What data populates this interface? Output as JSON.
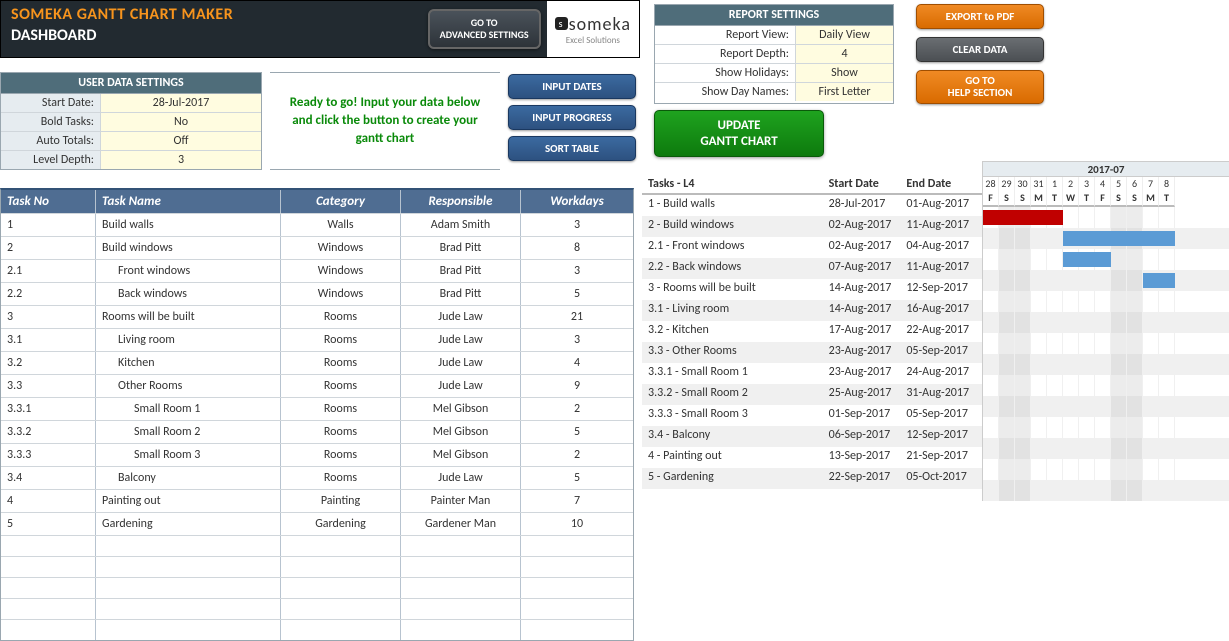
{
  "header": {
    "app_title": "SOMEKA GANTT CHART MAKER",
    "dash_title": "DASHBOARD",
    "adv_btn_l1": "GO TO",
    "adv_btn_l2": "ADVANCED SETTINGS",
    "logo_text": "someka",
    "logo_sub": "Excel Solutions"
  },
  "uds": {
    "title": "USER DATA SETTINGS",
    "rows": [
      {
        "label": "Start Date:",
        "value": "28-Jul-2017"
      },
      {
        "label": "Bold Tasks:",
        "value": "No"
      },
      {
        "label": "Auto Totals:",
        "value": "Off"
      },
      {
        "label": "Level Depth:",
        "value": "3"
      }
    ]
  },
  "ready_msg": "Ready to go! Input your data below and click the button to create your gantt chart",
  "act": {
    "input_dates": "INPUT DATES",
    "input_progress": "INPUT PROGRESS",
    "sort_table": "SORT TABLE"
  },
  "task_header": {
    "no": "Task No",
    "name": "Task Name",
    "cat": "Category",
    "resp": "Responsible",
    "wd": "Workdays"
  },
  "tasks": [
    {
      "no": "1",
      "name": "Build walls",
      "indent": 0,
      "cat": "Walls",
      "resp": "Adam Smith",
      "wd": "3"
    },
    {
      "no": "2",
      "name": "Build windows",
      "indent": 0,
      "cat": "Windows",
      "resp": "Brad Pitt",
      "wd": "8"
    },
    {
      "no": "2.1",
      "name": "Front windows",
      "indent": 1,
      "cat": "Windows",
      "resp": "Brad Pitt",
      "wd": "3"
    },
    {
      "no": "2.2",
      "name": "Back windows",
      "indent": 1,
      "cat": "Windows",
      "resp": "Brad Pitt",
      "wd": "5"
    },
    {
      "no": "3",
      "name": "Rooms will be built",
      "indent": 0,
      "cat": "Rooms",
      "resp": "Jude Law",
      "wd": "21"
    },
    {
      "no": "3.1",
      "name": "Living room",
      "indent": 1,
      "cat": "Rooms",
      "resp": "Jude Law",
      "wd": "3"
    },
    {
      "no": "3.2",
      "name": "Kitchen",
      "indent": 1,
      "cat": "Rooms",
      "resp": "Jude Law",
      "wd": "4"
    },
    {
      "no": "3.3",
      "name": "Other Rooms",
      "indent": 1,
      "cat": "Rooms",
      "resp": "Jude Law",
      "wd": "9"
    },
    {
      "no": "3.3.1",
      "name": "Small Room 1",
      "indent": 2,
      "cat": "Rooms",
      "resp": "Mel Gibson",
      "wd": "2"
    },
    {
      "no": "3.3.2",
      "name": "Small Room 2",
      "indent": 2,
      "cat": "Rooms",
      "resp": "Mel Gibson",
      "wd": "5"
    },
    {
      "no": "3.3.3",
      "name": "Small Room 3",
      "indent": 2,
      "cat": "Rooms",
      "resp": "Mel Gibson",
      "wd": "2"
    },
    {
      "no": "3.4",
      "name": "Balcony",
      "indent": 1,
      "cat": "Rooms",
      "resp": "Jude Law",
      "wd": "5"
    },
    {
      "no": "4",
      "name": "Painting out",
      "indent": 0,
      "cat": "Painting",
      "resp": "Painter Man",
      "wd": "7"
    },
    {
      "no": "5",
      "name": "Gardening",
      "indent": 0,
      "cat": "Gardening",
      "resp": "Gardener Man",
      "wd": "10"
    }
  ],
  "empty_rows": 5,
  "rs": {
    "title": "REPORT SETTINGS",
    "rows": [
      {
        "label": "Report View:",
        "value": "Daily View"
      },
      {
        "label": "Report Depth:",
        "value": "4"
      },
      {
        "label": "Show Holidays:",
        "value": "Show"
      },
      {
        "label": "Show Day Names:",
        "value": "First Letter"
      }
    ]
  },
  "rbtn": {
    "export": "EXPORT to PDF",
    "clear": "CLEAR DATA",
    "help_l1": "GO TO",
    "help_l2": "HELP SECTION",
    "update_l1": "UPDATE",
    "update_l2": "GANTT CHART"
  },
  "gantt_hdr": {
    "tasks": "Tasks - L4",
    "start": "Start Date",
    "end": "End Date",
    "month": "2017-07"
  },
  "gantt_rows": [
    {
      "task": "1 - Build walls",
      "start": "28-Jul-2017",
      "end": "01-Aug-2017"
    },
    {
      "task": "2 - Build windows",
      "start": "02-Aug-2017",
      "end": "11-Aug-2017"
    },
    {
      "task": "2.1 - Front windows",
      "start": "02-Aug-2017",
      "end": "04-Aug-2017"
    },
    {
      "task": "2.2 - Back windows",
      "start": "07-Aug-2017",
      "end": "11-Aug-2017"
    },
    {
      "task": "3 - Rooms will be built",
      "start": "14-Aug-2017",
      "end": "12-Sep-2017"
    },
    {
      "task": "3.1 - Living room",
      "start": "14-Aug-2017",
      "end": "16-Aug-2017"
    },
    {
      "task": "3.2 - Kitchen",
      "start": "17-Aug-2017",
      "end": "22-Aug-2017"
    },
    {
      "task": "3.3 - Other Rooms",
      "start": "23-Aug-2017",
      "end": "05-Sep-2017"
    },
    {
      "task": "3.3.1 - Small Room 1",
      "start": "23-Aug-2017",
      "end": "24-Aug-2017"
    },
    {
      "task": "3.3.2 - Small Room 2",
      "start": "25-Aug-2017",
      "end": "31-Aug-2017"
    },
    {
      "task": "3.3.3 - Small Room 3",
      "start": "01-Sep-2017",
      "end": "05-Sep-2017"
    },
    {
      "task": "3.4 - Balcony",
      "start": "06-Sep-2017",
      "end": "12-Sep-2017"
    },
    {
      "task": "4 - Painting out",
      "start": "13-Sep-2017",
      "end": "21-Sep-2017"
    },
    {
      "task": "5 - Gardening",
      "start": "22-Sep-2017",
      "end": "05-Oct-2017"
    }
  ],
  "chart_data": {
    "type": "gantt",
    "timeline_start": "2017-07-28",
    "visible_days": 12,
    "day_numbers": [
      "28",
      "29",
      "30",
      "31",
      "1",
      "2",
      "3",
      "4",
      "5",
      "6",
      "7",
      "8"
    ],
    "day_letters": [
      "F",
      "S",
      "S",
      "M",
      "T",
      "W",
      "T",
      "F",
      "S",
      "S",
      "M",
      "T"
    ],
    "weekend_idx": [
      1,
      2,
      8,
      9
    ],
    "bars": [
      {
        "row": 0,
        "start_idx": 0,
        "span": 5,
        "color": "red"
      },
      {
        "row": 1,
        "start_idx": 5,
        "span": 7,
        "color": "blue"
      },
      {
        "row": 2,
        "start_idx": 5,
        "span": 3,
        "color": "blue"
      },
      {
        "row": 3,
        "start_idx": 10,
        "span": 2,
        "color": "blue"
      }
    ]
  }
}
